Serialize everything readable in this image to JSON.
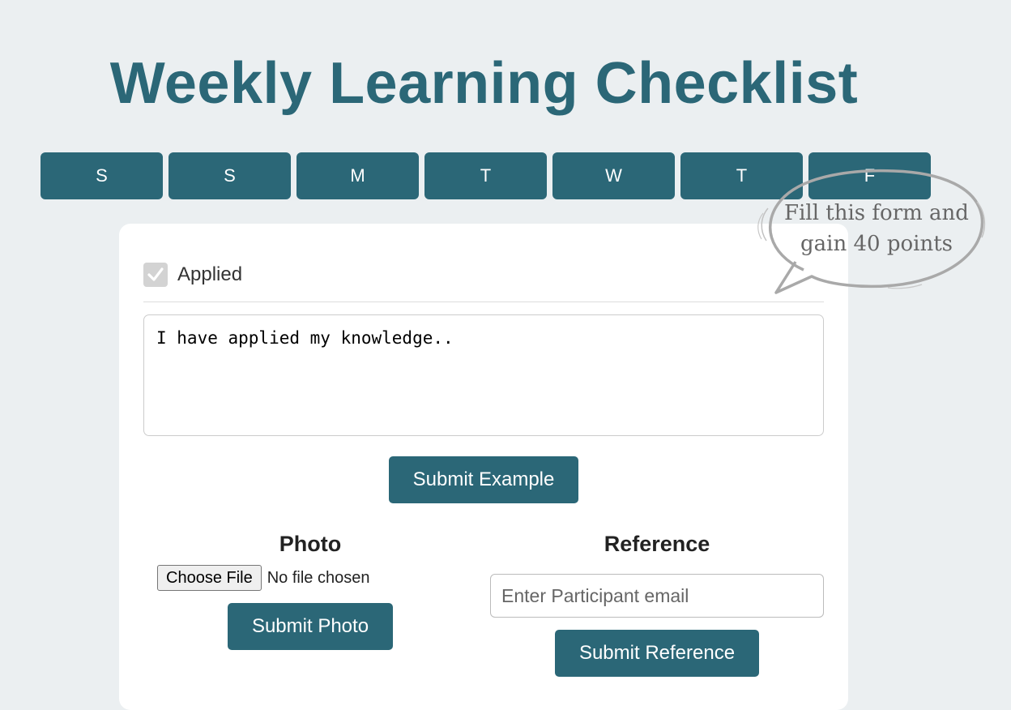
{
  "page": {
    "title": "Weekly Learning Checklist"
  },
  "days": [
    "S",
    "S",
    "M",
    "T",
    "W",
    "T",
    "F"
  ],
  "callout": {
    "line1": "Fill this form and",
    "line2": "gain 40 points"
  },
  "form": {
    "checkbox_label": "Applied",
    "checked": true,
    "textarea_value": "I have applied my knowledge..",
    "submit_example": "Submit Example",
    "photo": {
      "heading": "Photo",
      "choose_file": "Choose File",
      "file_status": "No file chosen",
      "submit": "Submit Photo"
    },
    "reference": {
      "heading": "Reference",
      "email_placeholder": "Enter Participant email",
      "submit": "Submit Reference"
    }
  },
  "colors": {
    "accent": "#2b6777",
    "background": "#ebeff1",
    "card": "#ffffff"
  },
  "icons": {
    "checkbox": "checkmark-icon"
  }
}
